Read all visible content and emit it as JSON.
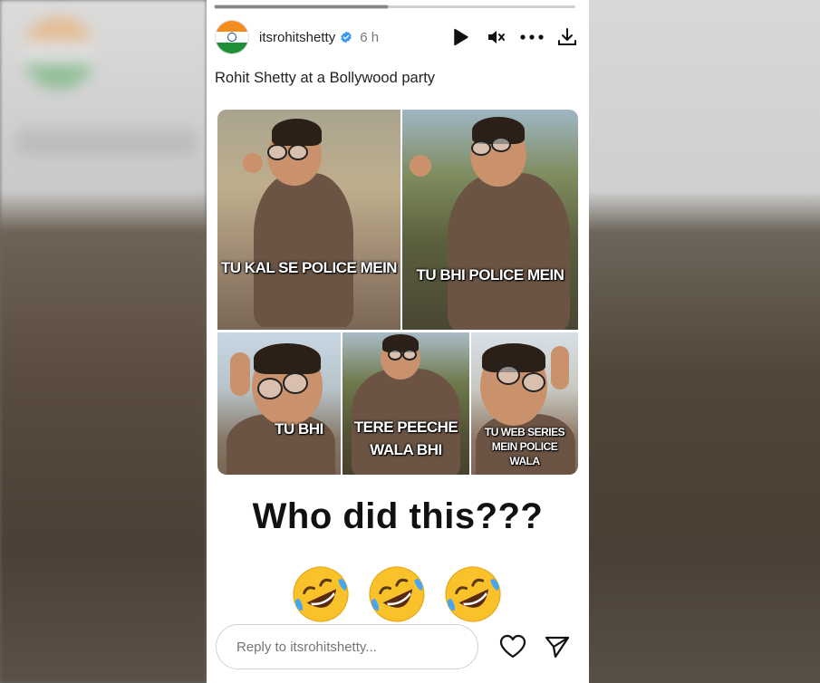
{
  "story": {
    "progress": 0.48,
    "username": "itsrohitshetty",
    "time": "6 h",
    "caption": "Rohit Shetty at a Bollywood party"
  },
  "icons": {
    "verified": "verified-badge-icon",
    "play": "play-icon",
    "mute": "mute-icon",
    "more": "more-options-icon",
    "download": "download-icon",
    "heart": "heart-icon",
    "send": "send-icon"
  },
  "meme": {
    "panel1": "TU KAL SE POLICE MEIN",
    "panel2": "TU BHI POLICE MEIN",
    "panel3": "TU BHI",
    "panel4_line1": "TERE PEECHE",
    "panel4_line2": "WALA BHI",
    "panel5_line1": "TU WEB SERIES",
    "panel5_line2": "MEIN POLICE",
    "panel5_line3": "WALA"
  },
  "text": "Who did this???",
  "emojis": [
    "rolling-on-floor-laughing",
    "rolling-on-floor-laughing",
    "rolling-on-floor-laughing"
  ],
  "reply": {
    "placeholder": "Reply to itsrohitshetty..."
  },
  "colors": {
    "flag_saffron": "#f28c1d",
    "flag_green": "#1f8f3a",
    "verified_blue": "#3897f0"
  }
}
